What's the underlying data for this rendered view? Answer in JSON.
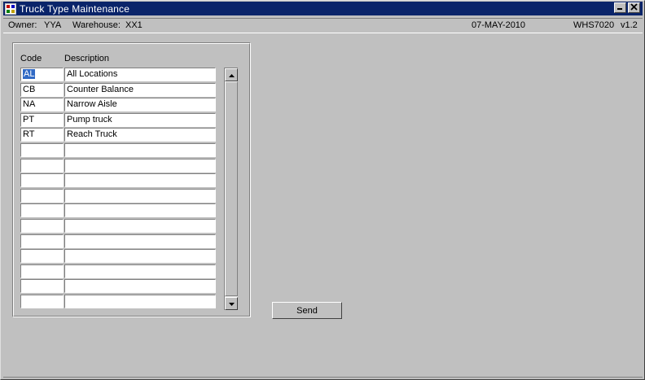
{
  "window": {
    "title": "Truck Type Maintenance"
  },
  "titlebar_buttons": {
    "minimize_icon": "minimize-icon",
    "close_icon": "close-icon"
  },
  "status": {
    "owner_label": "Owner:",
    "owner_value": "YYA",
    "warehouse_label": "Warehouse:",
    "warehouse_value": "XX1",
    "date": "07-MAY-2010",
    "screen_id": "WHS7020",
    "version": "v1.2"
  },
  "grid": {
    "headers": {
      "code": "Code",
      "description": "Description"
    },
    "rows": [
      {
        "code": "AL",
        "description": "All Locations"
      },
      {
        "code": "CB",
        "description": "Counter Balance"
      },
      {
        "code": "NA",
        "description": "Narrow Aisle"
      },
      {
        "code": "PT",
        "description": "Pump truck"
      },
      {
        "code": "RT",
        "description": "Reach Truck"
      },
      {
        "code": "",
        "description": ""
      },
      {
        "code": "",
        "description": ""
      },
      {
        "code": "",
        "description": ""
      },
      {
        "code": "",
        "description": ""
      },
      {
        "code": "",
        "description": ""
      },
      {
        "code": "",
        "description": ""
      },
      {
        "code": "",
        "description": ""
      },
      {
        "code": "",
        "description": ""
      },
      {
        "code": "",
        "description": ""
      },
      {
        "code": "",
        "description": ""
      },
      {
        "code": "",
        "description": ""
      }
    ]
  },
  "actions": {
    "send_label": "Send"
  }
}
